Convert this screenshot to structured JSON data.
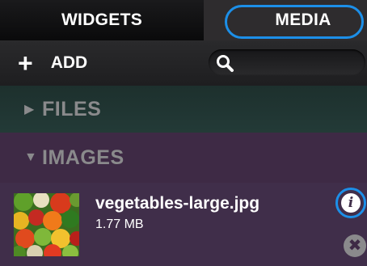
{
  "tabs": [
    {
      "label": "WIDGETS"
    },
    {
      "label": "MEDIA"
    }
  ],
  "toolbar": {
    "add_icon": "+",
    "add_label": "ADD",
    "search_icon": "search-icon"
  },
  "sections": {
    "files": {
      "arrow": "▶",
      "label": "FILES"
    },
    "images": {
      "arrow": "▼",
      "label": "IMAGES"
    }
  },
  "media_item": {
    "filename": "vegetables-large.jpg",
    "size": "1.77 MB",
    "info_icon": "i",
    "remove_icon": "✖"
  },
  "colors": {
    "accent": "#1c8fe8",
    "files_bg": "#1d302d",
    "images_bg": "#3e2a45"
  }
}
